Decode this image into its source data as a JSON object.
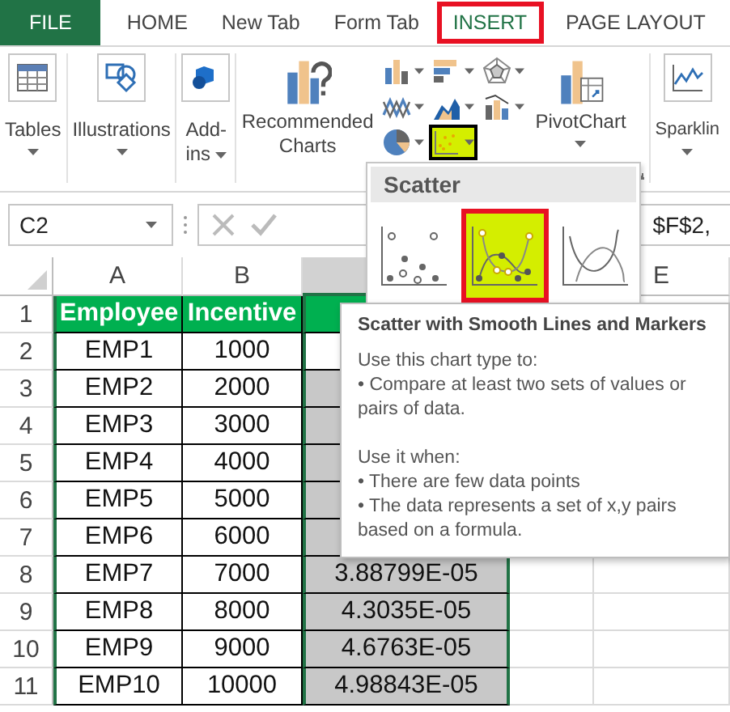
{
  "tabs": [
    {
      "label": "FILE",
      "kind": "file",
      "selected": false
    },
    {
      "label": "HOME",
      "kind": "tab",
      "selected": false
    },
    {
      "label": "New Tab",
      "kind": "tab",
      "selected": false
    },
    {
      "label": "Form Tab",
      "kind": "tab",
      "selected": false
    },
    {
      "label": "INSERT",
      "kind": "tab",
      "selected": true
    },
    {
      "label": "PAGE LAYOUT",
      "kind": "tab",
      "selected": false
    }
  ],
  "ribbon": [
    {
      "items": [
        {
          "kind": "tables",
          "lines": [
            "Tables"
          ],
          "dropdown": true
        }
      ]
    },
    {
      "items": [
        {
          "kind": "illustrations",
          "lines": [
            "Illustrations"
          ],
          "dropdown": true
        }
      ]
    },
    {
      "items": [
        {
          "kind": "addins",
          "lines": [
            "Add-",
            "ins"
          ],
          "dropdown": true
        }
      ]
    },
    {
      "launcher": true,
      "items": [
        {
          "kind": "recommended",
          "lines": [
            "Recommended",
            "Charts"
          ],
          "dropdown": false
        },
        {
          "kind": "chart_grid",
          "buttons": [
            {
              "kind": "column",
              "selected": false
            },
            {
              "kind": "bar",
              "selected": false
            },
            {
              "kind": "radar",
              "selected": false
            },
            {
              "kind": "line",
              "selected": false
            },
            {
              "kind": "area",
              "selected": false
            },
            {
              "kind": "combo",
              "selected": false
            },
            {
              "kind": "pie",
              "selected": false
            },
            {
              "kind": "scatter",
              "selected": true
            }
          ]
        },
        {
          "kind": "pivotchart",
          "lines": [
            "PivotChart"
          ],
          "dropdown": true
        }
      ]
    },
    {
      "items": [
        {
          "kind": "sparklines",
          "lines": [
            "Sparklin"
          ],
          "dropdown": true
        }
      ]
    }
  ],
  "name_box": "C2",
  "formula": "$F$2,",
  "column_headers": [
    "A",
    "B",
    "E"
  ],
  "rows": [
    {
      "number": "1",
      "kind": "header",
      "employee": "Employee",
      "incentive": "Incentive"
    },
    {
      "number": "2",
      "kind": "data",
      "employee": "EMP1",
      "incentive": "1000",
      "c_selected": false
    },
    {
      "number": "3",
      "kind": "data",
      "employee": "EMP2",
      "incentive": "2000",
      "c_selected": true
    },
    {
      "number": "4",
      "kind": "data",
      "employee": "EMP3",
      "incentive": "3000",
      "c_selected": true
    },
    {
      "number": "5",
      "kind": "data",
      "employee": "EMP4",
      "incentive": "4000",
      "c_selected": true
    },
    {
      "number": "6",
      "kind": "data",
      "employee": "EMP5",
      "incentive": "5000",
      "c_selected": true
    },
    {
      "number": "7",
      "kind": "data",
      "employee": "EMP6",
      "incentive": "6000",
      "c_selected": true
    },
    {
      "number": "8",
      "kind": "data",
      "employee": "EMP7",
      "incentive": "7000",
      "value": "3.88799E-05",
      "c_selected": true
    },
    {
      "number": "9",
      "kind": "data",
      "employee": "EMP8",
      "incentive": "8000",
      "value": "4.3035E-05",
      "c_selected": true
    },
    {
      "number": "10",
      "kind": "data",
      "employee": "EMP9",
      "incentive": "9000",
      "value": "4.6763E-05",
      "c_selected": true
    },
    {
      "number": "11",
      "kind": "data",
      "employee": "EMP10",
      "incentive": "10000",
      "value": "4.98843E-05",
      "c_selected": true
    }
  ],
  "scatter_menu": {
    "title": "Scatter",
    "options": [
      {
        "kind": "markers",
        "selected": false
      },
      {
        "kind": "smooth_markers",
        "selected": true
      },
      {
        "kind": "smooth",
        "selected": false
      }
    ]
  },
  "tooltip": {
    "title": "Scatter with Smooth Lines and Markers",
    "sections": [
      {
        "heading": "Use this chart type to:",
        "bullets": [
          "• Compare at least two sets of values or pairs of data."
        ]
      },
      {
        "heading": "Use it when:",
        "bullets": [
          "• There are few data points",
          "• The data represents a set of x,y pairs based on a formula."
        ]
      }
    ]
  }
}
